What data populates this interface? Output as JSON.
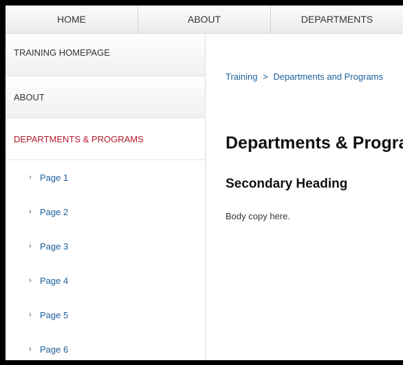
{
  "topnav": {
    "items": [
      "HOME",
      "ABOUT",
      "DEPARTMENTS"
    ]
  },
  "sidebar": {
    "main_items": [
      "TRAINING HOMEPAGE",
      "ABOUT",
      "DEPARTMENTS & PROGRAMS"
    ],
    "active_item": "DEPARTMENTS & PROGRAMS",
    "sub_items": [
      "Page 1",
      "Page 2",
      "Page 3",
      "Page 4",
      "Page 5",
      "Page 6"
    ],
    "chevron": "›"
  },
  "content": {
    "breadcrumb": [
      "Training",
      ">",
      "Departments and Programs"
    ],
    "page_title": "Departments & Programs",
    "secondary_heading": "Secondary Heading",
    "body_copy": "Body copy here."
  },
  "colors": {
    "active": "#b5182d",
    "link": "#1a5e9a"
  }
}
